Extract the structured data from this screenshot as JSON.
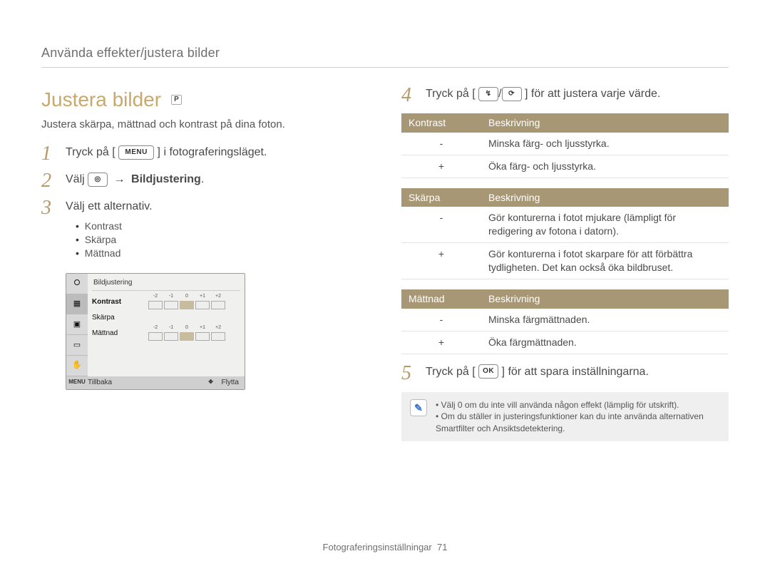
{
  "running_head": "Använda effekter/justera bilder",
  "title": "Justera bilder",
  "mode_badge": "P",
  "lede": "Justera skärpa, mättnad och kontrast på dina foton.",
  "icons": {
    "menu": "MENU",
    "camera": "◎",
    "flash": "↯",
    "timer": "⟳",
    "ok": "OK",
    "arrow": "→"
  },
  "steps_left": {
    "s1_a": "Tryck på [",
    "s1_b": "] i fotograferingsläget.",
    "s2_a": "Välj ",
    "s2_bold": "Bildjustering",
    "s2_b": ".",
    "s3": "Välj ett alternativ."
  },
  "alternatives": [
    "Kontrast",
    "Skärpa",
    "Mättnad"
  ],
  "camera_ui": {
    "head": "Bildjustering",
    "rows": [
      "Kontrast",
      "Skärpa",
      "Mättnad"
    ],
    "ticks": [
      "-2",
      "-1",
      "0",
      "+1",
      "+2"
    ],
    "back": "Tillbaka",
    "move": "Flytta",
    "menu_chip": "MENU"
  },
  "steps_right": {
    "s4_a": "Tryck på [",
    "s4_b": "] för att justera varje värde.",
    "s5_a": "Tryck på [",
    "s5_b": "] för att spara inställningarna."
  },
  "tables": [
    {
      "h1": "Kontrast",
      "h2": "Beskrivning",
      "rows": [
        {
          "k": "-",
          "v": "Minska färg- och ljusstyrka."
        },
        {
          "k": "+",
          "v": "Öka färg- och ljusstyrka."
        }
      ]
    },
    {
      "h1": "Skärpa",
      "h2": "Beskrivning",
      "rows": [
        {
          "k": "-",
          "v": "Gör konturerna i fotot mjukare (lämpligt för redigering av fotona i datorn)."
        },
        {
          "k": "+",
          "v": "Gör konturerna i fotot skarpare för att förbättra tydligheten. Det kan också öka bildbruset."
        }
      ]
    },
    {
      "h1": "Mättnad",
      "h2": "Beskrivning",
      "rows": [
        {
          "k": "-",
          "v": "Minska färgmättnaden."
        },
        {
          "k": "+",
          "v": "Öka färgmättnaden."
        }
      ]
    }
  ],
  "note": [
    "Välj 0 om du inte vill använda någon effekt (lämplig för utskrift).",
    "Om du ställer in justeringsfunktioner kan du inte använda alternativen Smartfilter och Ansiktsdetektering."
  ],
  "footer_label": "Fotograferingsinställningar",
  "footer_page": "71"
}
